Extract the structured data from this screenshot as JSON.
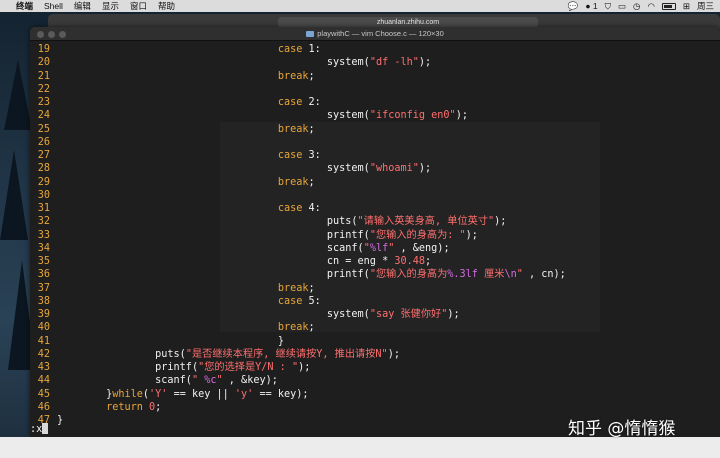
{
  "menubar": {
    "apple": "",
    "app_name": "终端",
    "items": [
      "Shell",
      "编辑",
      "显示",
      "窗口",
      "帮助"
    ],
    "notification_count": "1",
    "clock": "周三"
  },
  "browser": {
    "url": "zhuanlan.zhihu.com"
  },
  "terminal": {
    "title": "playwithC — vim Choose.c — 120×30",
    "command_line": ":x"
  },
  "code_lines": [
    {
      "n": "19",
      "indent": 36,
      "parts": [
        [
          "kw",
          "case "
        ],
        [
          "",
          "1:"
        ]
      ]
    },
    {
      "n": "20",
      "indent": 44,
      "parts": [
        [
          "",
          "system("
        ],
        [
          "str",
          "\"df -lh\""
        ],
        [
          "",
          ");"
        ]
      ]
    },
    {
      "n": "21",
      "indent": 36,
      "parts": [
        [
          "kw",
          "break"
        ],
        [
          "",
          ";"
        ]
      ]
    },
    {
      "n": "22",
      "indent": 0,
      "parts": []
    },
    {
      "n": "23",
      "indent": 36,
      "parts": [
        [
          "kw",
          "case "
        ],
        [
          "",
          "2:"
        ]
      ]
    },
    {
      "n": "24",
      "indent": 44,
      "parts": [
        [
          "",
          "system("
        ],
        [
          "str",
          "\"ifconfig en0\""
        ],
        [
          "",
          ");"
        ]
      ]
    },
    {
      "n": "25",
      "indent": 36,
      "parts": [
        [
          "kw",
          "break"
        ],
        [
          "",
          ";"
        ]
      ]
    },
    {
      "n": "26",
      "indent": 0,
      "parts": []
    },
    {
      "n": "27",
      "indent": 36,
      "parts": [
        [
          "kw",
          "case "
        ],
        [
          "",
          "3:"
        ]
      ]
    },
    {
      "n": "28",
      "indent": 44,
      "parts": [
        [
          "",
          "system("
        ],
        [
          "str",
          "\"whoami\""
        ],
        [
          "",
          ");"
        ]
      ]
    },
    {
      "n": "29",
      "indent": 36,
      "parts": [
        [
          "kw",
          "break"
        ],
        [
          "",
          ";"
        ]
      ]
    },
    {
      "n": "30",
      "indent": 0,
      "parts": []
    },
    {
      "n": "31",
      "indent": 36,
      "parts": [
        [
          "kw",
          "case "
        ],
        [
          "",
          "4:"
        ]
      ]
    },
    {
      "n": "32",
      "indent": 44,
      "parts": [
        [
          "",
          "puts("
        ],
        [
          "str",
          "\"请输入英美身高, 单位英寸\""
        ],
        [
          "",
          ");"
        ]
      ]
    },
    {
      "n": "33",
      "indent": 44,
      "parts": [
        [
          "",
          "printf("
        ],
        [
          "str",
          "\"您输入的身高为: \""
        ],
        [
          "",
          ");"
        ]
      ]
    },
    {
      "n": "34",
      "indent": 44,
      "parts": [
        [
          "",
          "scanf("
        ],
        [
          "str",
          "\""
        ],
        [
          "fmt",
          "%lf"
        ],
        [
          "str",
          "\""
        ],
        [
          "",
          " , &eng);"
        ]
      ]
    },
    {
      "n": "35",
      "indent": 44,
      "parts": [
        [
          "",
          "cn = eng * "
        ],
        [
          "num",
          "30.48"
        ],
        [
          "",
          ";"
        ]
      ]
    },
    {
      "n": "36",
      "indent": 44,
      "parts": [
        [
          "",
          "printf("
        ],
        [
          "str",
          "\"您输入的身高为"
        ],
        [
          "fmt",
          "%.3lf"
        ],
        [
          "str",
          " 厘米"
        ],
        [
          "fmt",
          "\\n"
        ],
        [
          "str",
          "\""
        ],
        [
          "",
          " , cn);"
        ]
      ]
    },
    {
      "n": "37",
      "indent": 36,
      "parts": [
        [
          "kw",
          "break"
        ],
        [
          "",
          ";"
        ]
      ]
    },
    {
      "n": "38",
      "indent": 36,
      "parts": [
        [
          "kw",
          "case "
        ],
        [
          "",
          "5:"
        ]
      ]
    },
    {
      "n": "39",
      "indent": 44,
      "parts": [
        [
          "",
          "system("
        ],
        [
          "str",
          "\"say 张健你好\""
        ],
        [
          "",
          ");"
        ]
      ]
    },
    {
      "n": "40",
      "indent": 36,
      "parts": [
        [
          "kw",
          "break"
        ],
        [
          "",
          ";"
        ]
      ]
    },
    {
      "n": "41",
      "indent": 36,
      "parts": [
        [
          "",
          "}"
        ]
      ]
    },
    {
      "n": "42",
      "indent": 16,
      "parts": [
        [
          "",
          "puts("
        ],
        [
          "str",
          "\"是否继续本程序, 继续请按Y, 推出请按N\""
        ],
        [
          "",
          ");"
        ]
      ]
    },
    {
      "n": "43",
      "indent": 16,
      "parts": [
        [
          "",
          "printf("
        ],
        [
          "str",
          "\"您的选择是Y/N : \""
        ],
        [
          "",
          ");"
        ]
      ]
    },
    {
      "n": "44",
      "indent": 16,
      "parts": [
        [
          "",
          "scanf("
        ],
        [
          "str",
          "\" "
        ],
        [
          "fmt",
          "%c"
        ],
        [
          "str",
          "\""
        ],
        [
          "",
          " , &key);"
        ]
      ]
    },
    {
      "n": "45",
      "indent": 8,
      "parts": [
        [
          "",
          "}"
        ],
        [
          "kw",
          "while"
        ],
        [
          "",
          "("
        ],
        [
          "str",
          "'Y'"
        ],
        [
          "",
          " == key || "
        ],
        [
          "str",
          "'y'"
        ],
        [
          "",
          " == key);"
        ]
      ]
    },
    {
      "n": "46",
      "indent": 8,
      "parts": [
        [
          "kw",
          "return "
        ],
        [
          "num",
          "0"
        ],
        [
          "",
          ";"
        ]
      ]
    },
    {
      "n": "47",
      "indent": 0,
      "parts": [
        [
          "",
          "}"
        ]
      ]
    }
  ],
  "watermark": "知乎 @惰惰猴"
}
